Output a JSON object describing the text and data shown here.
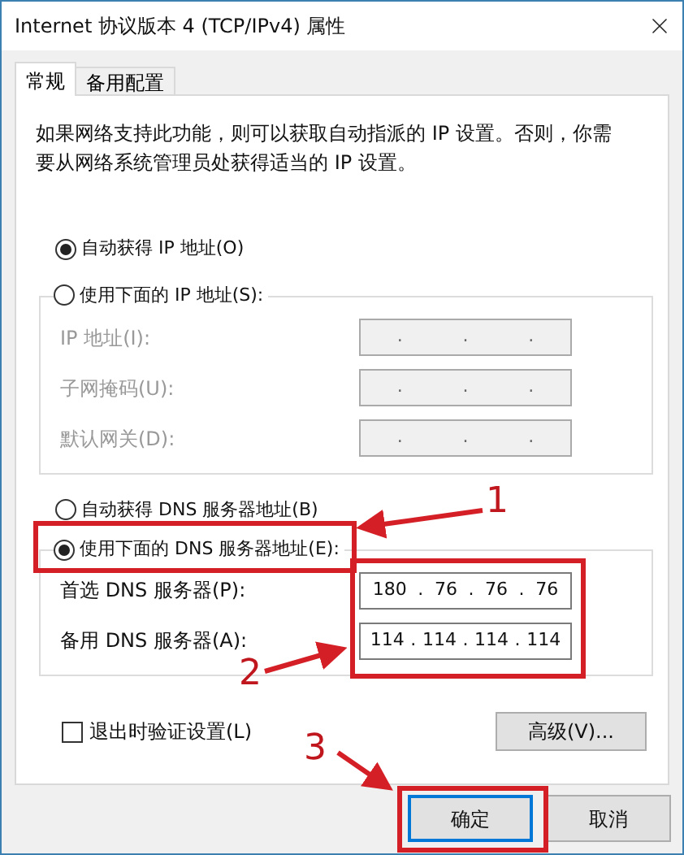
{
  "window": {
    "title": "Internet 协议版本 4 (TCP/IPv4) 属性"
  },
  "tabs": [
    {
      "label": "常规",
      "selected": true
    },
    {
      "label": "备用配置",
      "selected": false
    }
  ],
  "description": "如果网络支持此功能，则可以获取自动指派的 IP 设置。否则，你需要从网络系统管理员处获得适当的 IP 设置。",
  "ip_mode": [
    {
      "label": "自动获得 IP 地址(O)",
      "selected": true
    },
    {
      "label": "使用下面的 IP 地址(S):",
      "selected": false
    }
  ],
  "ip_fields": [
    {
      "label": "IP 地址(I):",
      "disabled": true,
      "segments": [
        ".",
        ".",
        "."
      ]
    },
    {
      "label": "子网掩码(U):",
      "disabled": true,
      "segments": [
        ".",
        ".",
        "."
      ]
    },
    {
      "label": "默认网关(D):",
      "disabled": true,
      "segments": [
        ".",
        ".",
        "."
      ]
    }
  ],
  "dns_mode": [
    {
      "label": "自动获得 DNS 服务器地址(B)",
      "selected": false
    },
    {
      "label": "使用下面的 DNS 服务器地址(E):",
      "selected": true
    }
  ],
  "dns_fields": [
    {
      "label": "首选 DNS 服务器(P):",
      "disabled": false,
      "segments": [
        "180",
        ".",
        "76",
        ".",
        "76",
        ".",
        "76"
      ]
    },
    {
      "label": "备用 DNS 服务器(A):",
      "disabled": false,
      "segments": [
        "114",
        ".",
        "114",
        ".",
        "114",
        ".",
        "114"
      ]
    }
  ],
  "validate_on_exit": {
    "label": "退出时验证设置(L)",
    "checked": false
  },
  "advanced_button": "高级(V)...",
  "buttons": [
    {
      "label": "确定",
      "focused": true
    },
    {
      "label": "取消",
      "focused": false
    }
  ],
  "annotations": [
    {
      "label": "1"
    },
    {
      "label": "2"
    },
    {
      "label": "3"
    }
  ]
}
